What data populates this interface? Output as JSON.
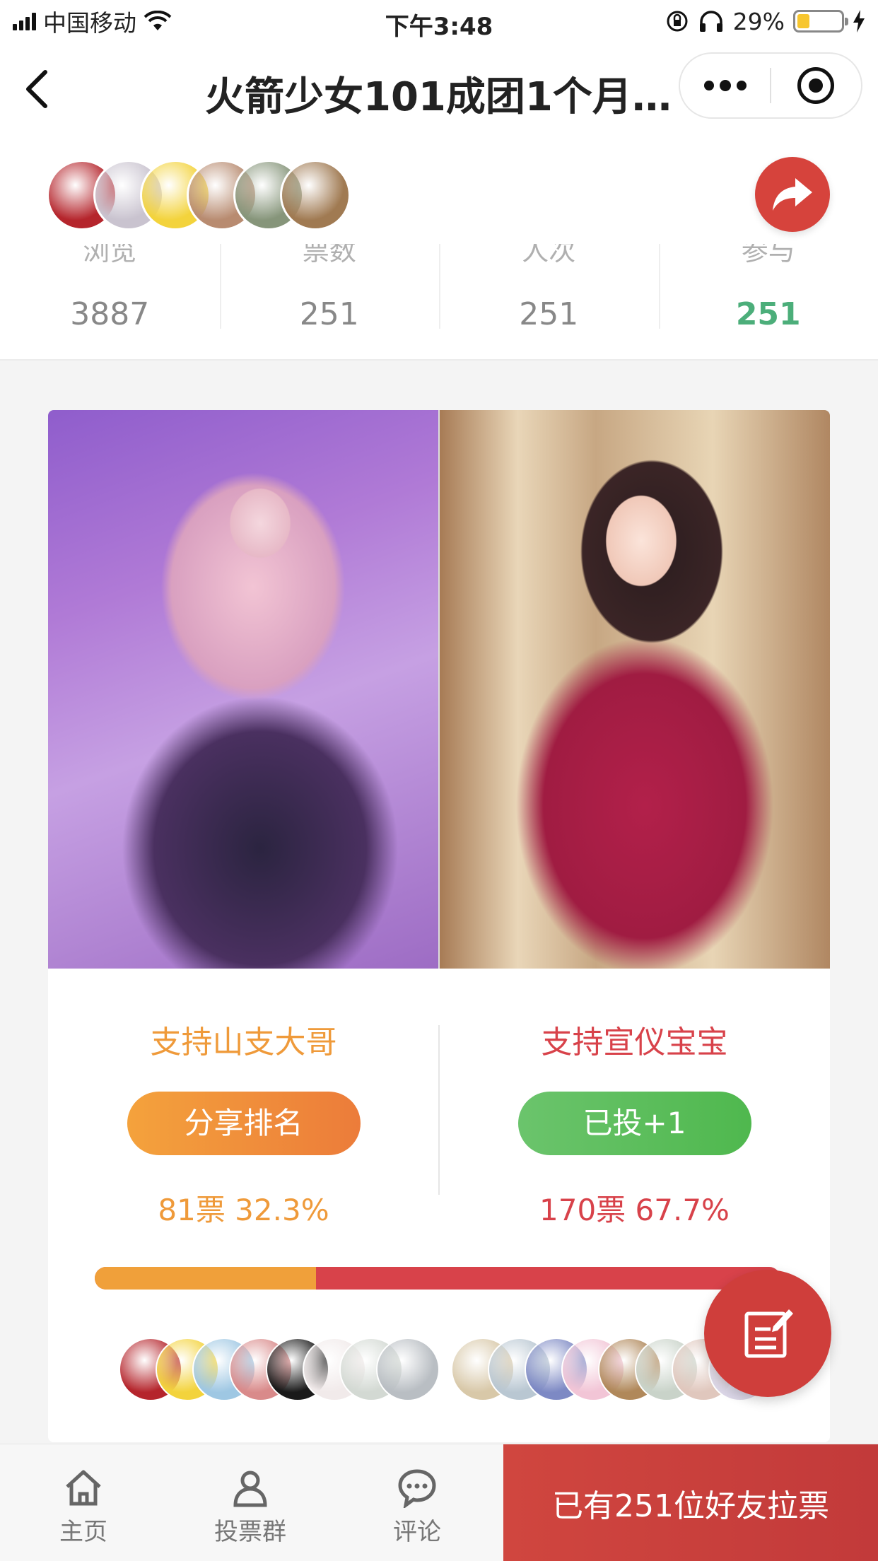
{
  "status_bar": {
    "carrier": "中国移动",
    "time": "下午3:48",
    "battery": "29%",
    "battery_level": 0.29
  },
  "nav": {
    "title": "火箭少女101成团1个月…"
  },
  "header": {
    "top_voter_avatar_colors": [
      "#b5252c",
      "#c9c3cf",
      "#f3d33c",
      "#b88b70",
      "#86957a",
      "#a07a52"
    ],
    "stats": [
      {
        "label": "浏览",
        "value": "3887"
      },
      {
        "label": "票数",
        "value": "251"
      },
      {
        "label": "人次",
        "value": "251"
      },
      {
        "label": "参与",
        "value": "251"
      }
    ]
  },
  "vote": {
    "left": {
      "name": "支持山支大哥",
      "button": "分享排名",
      "result": "81票 32.3%",
      "share": 0.323,
      "voter_colors": [
        "#b5252c",
        "#f3d33c",
        "#9ec7e3",
        "#d98a8a",
        "#1a1a1a",
        "#f1eaea",
        "#d3d9d3",
        "#b9bec3"
      ]
    },
    "right": {
      "name": "支持宣仪宝宝",
      "button": "已投+1",
      "result": "170票 67.7%",
      "share": 0.677,
      "voter_colors": [
        "#d8c8a8",
        "#b9c7d2",
        "#7d89c4",
        "#f2c5d6",
        "#b0885a",
        "#c9d3c9",
        "#e0c7bd",
        "#dcd7e8"
      ]
    }
  },
  "bottom": {
    "tabs": [
      {
        "label": "主页",
        "icon": "home-icon"
      },
      {
        "label": "投票群",
        "icon": "group-icon"
      },
      {
        "label": "评论",
        "icon": "comment-icon"
      }
    ],
    "invite": "已有251位好友拉票"
  }
}
